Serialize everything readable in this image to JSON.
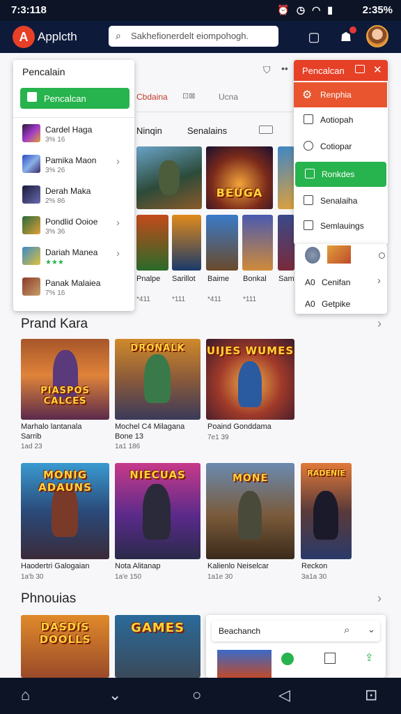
{
  "status": {
    "time": "7:3:118",
    "right": "2:35%"
  },
  "app": {
    "logo": "A",
    "name": "Applcth",
    "search_placeholder": "Sakhefionerdelt eiompohogh."
  },
  "colors": {
    "accent_red": "#e64027",
    "accent_green": "#27b34d",
    "nav_bg": "#0d1a3a"
  },
  "tabs": {
    "items": [
      "Cbdaina",
      "Ucna"
    ],
    "sub": [
      "Ninqin",
      "Senalains"
    ]
  },
  "left_menu": {
    "title": "Pencalain",
    "button": "Pencalcan",
    "items": [
      {
        "title": "Cardel Haga",
        "meta": "3% 16"
      },
      {
        "title": "Pamika Maon",
        "meta": "3% 26"
      },
      {
        "title": "Derah Maka",
        "meta": "2% 86"
      },
      {
        "title": "Pondlid Ooioe",
        "meta": "3% 36"
      },
      {
        "title": "Dariah Manea",
        "meta": "★★★"
      },
      {
        "title": "Panak Malaiea",
        "meta": "7% 16"
      }
    ]
  },
  "right_menu": {
    "title": "Pencalcan",
    "items": [
      "Renphia",
      "Aotiopah",
      "Cotiopar",
      "Ronkdes",
      "Senalaiha",
      "Semlauings"
    ],
    "footer": [
      "Cenifan",
      "Getpike"
    ],
    "footer_prefix": [
      "A0",
      "A0"
    ]
  },
  "row1": {
    "games": [
      {
        "name": "Pnalpe",
        "meta": "*411"
      },
      {
        "name": "Sarillot",
        "meta": "*111"
      },
      {
        "name": "Baime",
        "meta": "*411"
      },
      {
        "name": "Bonkal",
        "meta": "*111"
      },
      {
        "name": "Sam",
        "meta": ""
      }
    ]
  },
  "sec1": {
    "title": "Prand Kara",
    "games": [
      {
        "art": "PIASPOS CALCES",
        "name": "Marhalo lantanala",
        "sub": "Sarrib",
        "meta": "1ad 23"
      },
      {
        "art": "DRONALK",
        "name": "Mochel C4 Milagana",
        "sub": "Bone 13",
        "meta": "1a1 186"
      },
      {
        "art": "UIJES WUMES",
        "name": "Poaind Gonddama",
        "sub": "",
        "meta": "7e1 39"
      }
    ]
  },
  "sec2": {
    "games": [
      {
        "art": "MONIG ADAUNS",
        "name": "Haodertri Galogaian",
        "meta": "1a'b 30"
      },
      {
        "art": "NIECUAS",
        "name": "Nota Alitanap",
        "meta": "1a'e 150"
      },
      {
        "art": "MONE",
        "name": "Kalienlo Neiselcar",
        "meta": "1a1e 30"
      },
      {
        "art": "RADENIE",
        "name": "Reckon",
        "meta": "3a1a 30"
      }
    ]
  },
  "sec3": {
    "title": "Phnouias",
    "games": [
      {
        "art": "DASDIS DOOLLS"
      },
      {
        "art": "GAMES"
      }
    ],
    "widget_label": "Beachanch"
  }
}
